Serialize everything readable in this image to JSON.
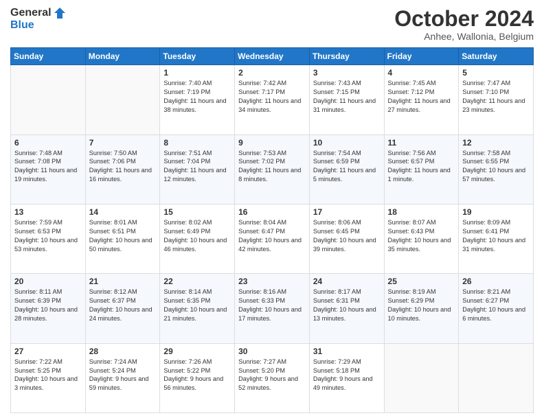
{
  "logo": {
    "line1": "General",
    "line2": "Blue"
  },
  "title": "October 2024",
  "subtitle": "Anhee, Wallonia, Belgium",
  "days_header": [
    "Sunday",
    "Monday",
    "Tuesday",
    "Wednesday",
    "Thursday",
    "Friday",
    "Saturday"
  ],
  "weeks": [
    [
      {
        "day": "",
        "sunrise": "",
        "sunset": "",
        "daylight": ""
      },
      {
        "day": "",
        "sunrise": "",
        "sunset": "",
        "daylight": ""
      },
      {
        "day": "1",
        "sunrise": "Sunrise: 7:40 AM",
        "sunset": "Sunset: 7:19 PM",
        "daylight": "Daylight: 11 hours and 38 minutes."
      },
      {
        "day": "2",
        "sunrise": "Sunrise: 7:42 AM",
        "sunset": "Sunset: 7:17 PM",
        "daylight": "Daylight: 11 hours and 34 minutes."
      },
      {
        "day": "3",
        "sunrise": "Sunrise: 7:43 AM",
        "sunset": "Sunset: 7:15 PM",
        "daylight": "Daylight: 11 hours and 31 minutes."
      },
      {
        "day": "4",
        "sunrise": "Sunrise: 7:45 AM",
        "sunset": "Sunset: 7:12 PM",
        "daylight": "Daylight: 11 hours and 27 minutes."
      },
      {
        "day": "5",
        "sunrise": "Sunrise: 7:47 AM",
        "sunset": "Sunset: 7:10 PM",
        "daylight": "Daylight: 11 hours and 23 minutes."
      }
    ],
    [
      {
        "day": "6",
        "sunrise": "Sunrise: 7:48 AM",
        "sunset": "Sunset: 7:08 PM",
        "daylight": "Daylight: 11 hours and 19 minutes."
      },
      {
        "day": "7",
        "sunrise": "Sunrise: 7:50 AM",
        "sunset": "Sunset: 7:06 PM",
        "daylight": "Daylight: 11 hours and 16 minutes."
      },
      {
        "day": "8",
        "sunrise": "Sunrise: 7:51 AM",
        "sunset": "Sunset: 7:04 PM",
        "daylight": "Daylight: 11 hours and 12 minutes."
      },
      {
        "day": "9",
        "sunrise": "Sunrise: 7:53 AM",
        "sunset": "Sunset: 7:02 PM",
        "daylight": "Daylight: 11 hours and 8 minutes."
      },
      {
        "day": "10",
        "sunrise": "Sunrise: 7:54 AM",
        "sunset": "Sunset: 6:59 PM",
        "daylight": "Daylight: 11 hours and 5 minutes."
      },
      {
        "day": "11",
        "sunrise": "Sunrise: 7:56 AM",
        "sunset": "Sunset: 6:57 PM",
        "daylight": "Daylight: 11 hours and 1 minute."
      },
      {
        "day": "12",
        "sunrise": "Sunrise: 7:58 AM",
        "sunset": "Sunset: 6:55 PM",
        "daylight": "Daylight: 10 hours and 57 minutes."
      }
    ],
    [
      {
        "day": "13",
        "sunrise": "Sunrise: 7:59 AM",
        "sunset": "Sunset: 6:53 PM",
        "daylight": "Daylight: 10 hours and 53 minutes."
      },
      {
        "day": "14",
        "sunrise": "Sunrise: 8:01 AM",
        "sunset": "Sunset: 6:51 PM",
        "daylight": "Daylight: 10 hours and 50 minutes."
      },
      {
        "day": "15",
        "sunrise": "Sunrise: 8:02 AM",
        "sunset": "Sunset: 6:49 PM",
        "daylight": "Daylight: 10 hours and 46 minutes."
      },
      {
        "day": "16",
        "sunrise": "Sunrise: 8:04 AM",
        "sunset": "Sunset: 6:47 PM",
        "daylight": "Daylight: 10 hours and 42 minutes."
      },
      {
        "day": "17",
        "sunrise": "Sunrise: 8:06 AM",
        "sunset": "Sunset: 6:45 PM",
        "daylight": "Daylight: 10 hours and 39 minutes."
      },
      {
        "day": "18",
        "sunrise": "Sunrise: 8:07 AM",
        "sunset": "Sunset: 6:43 PM",
        "daylight": "Daylight: 10 hours and 35 minutes."
      },
      {
        "day": "19",
        "sunrise": "Sunrise: 8:09 AM",
        "sunset": "Sunset: 6:41 PM",
        "daylight": "Daylight: 10 hours and 31 minutes."
      }
    ],
    [
      {
        "day": "20",
        "sunrise": "Sunrise: 8:11 AM",
        "sunset": "Sunset: 6:39 PM",
        "daylight": "Daylight: 10 hours and 28 minutes."
      },
      {
        "day": "21",
        "sunrise": "Sunrise: 8:12 AM",
        "sunset": "Sunset: 6:37 PM",
        "daylight": "Daylight: 10 hours and 24 minutes."
      },
      {
        "day": "22",
        "sunrise": "Sunrise: 8:14 AM",
        "sunset": "Sunset: 6:35 PM",
        "daylight": "Daylight: 10 hours and 21 minutes."
      },
      {
        "day": "23",
        "sunrise": "Sunrise: 8:16 AM",
        "sunset": "Sunset: 6:33 PM",
        "daylight": "Daylight: 10 hours and 17 minutes."
      },
      {
        "day": "24",
        "sunrise": "Sunrise: 8:17 AM",
        "sunset": "Sunset: 6:31 PM",
        "daylight": "Daylight: 10 hours and 13 minutes."
      },
      {
        "day": "25",
        "sunrise": "Sunrise: 8:19 AM",
        "sunset": "Sunset: 6:29 PM",
        "daylight": "Daylight: 10 hours and 10 minutes."
      },
      {
        "day": "26",
        "sunrise": "Sunrise: 8:21 AM",
        "sunset": "Sunset: 6:27 PM",
        "daylight": "Daylight: 10 hours and 6 minutes."
      }
    ],
    [
      {
        "day": "27",
        "sunrise": "Sunrise: 7:22 AM",
        "sunset": "Sunset: 5:25 PM",
        "daylight": "Daylight: 10 hours and 3 minutes."
      },
      {
        "day": "28",
        "sunrise": "Sunrise: 7:24 AM",
        "sunset": "Sunset: 5:24 PM",
        "daylight": "Daylight: 9 hours and 59 minutes."
      },
      {
        "day": "29",
        "sunrise": "Sunrise: 7:26 AM",
        "sunset": "Sunset: 5:22 PM",
        "daylight": "Daylight: 9 hours and 56 minutes."
      },
      {
        "day": "30",
        "sunrise": "Sunrise: 7:27 AM",
        "sunset": "Sunset: 5:20 PM",
        "daylight": "Daylight: 9 hours and 52 minutes."
      },
      {
        "day": "31",
        "sunrise": "Sunrise: 7:29 AM",
        "sunset": "Sunset: 5:18 PM",
        "daylight": "Daylight: 9 hours and 49 minutes."
      },
      {
        "day": "",
        "sunrise": "",
        "sunset": "",
        "daylight": ""
      },
      {
        "day": "",
        "sunrise": "",
        "sunset": "",
        "daylight": ""
      }
    ]
  ]
}
